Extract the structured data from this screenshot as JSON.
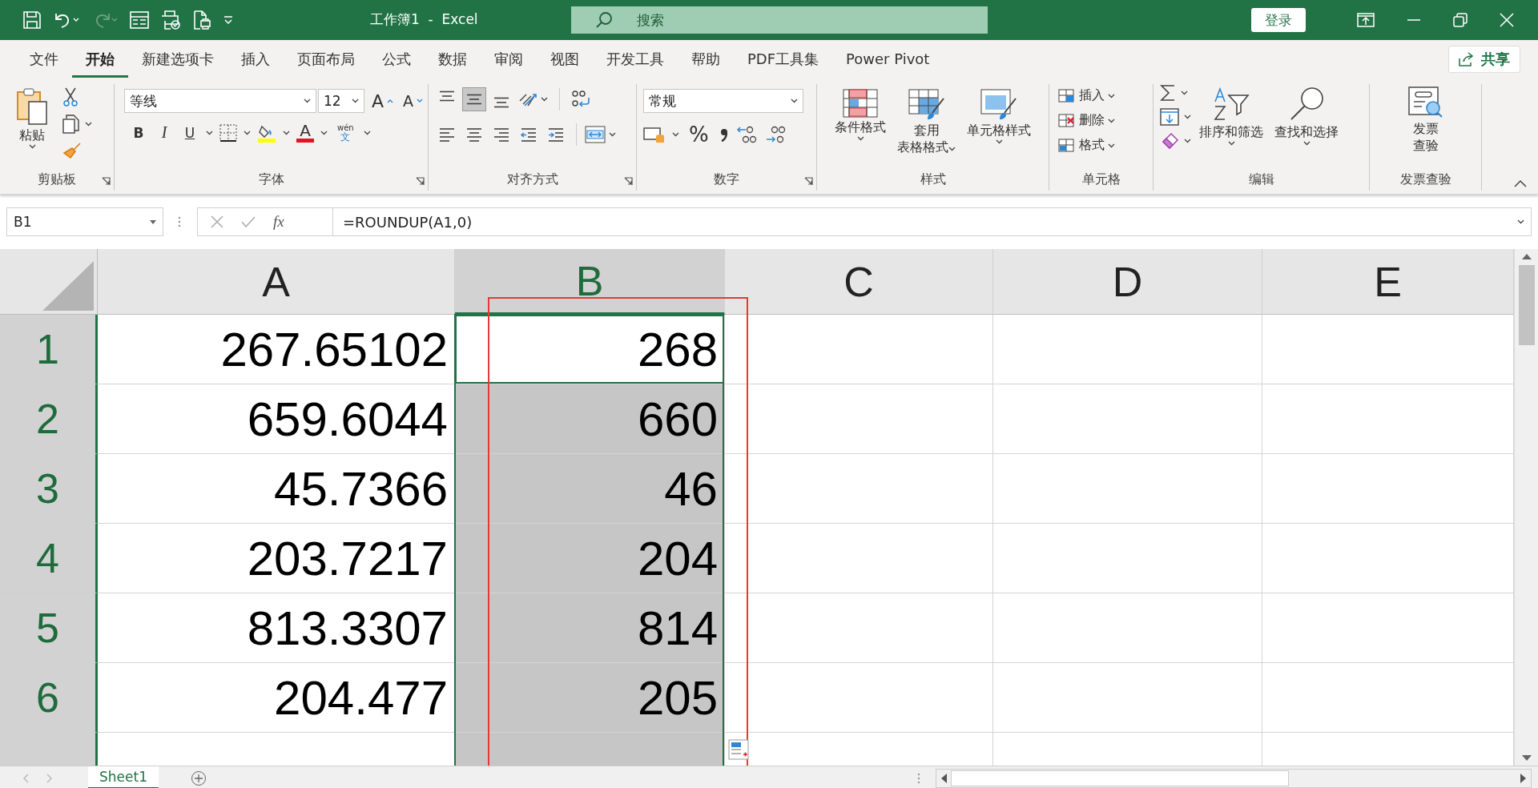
{
  "window": {
    "title": "工作簿1  -  Excel",
    "search_placeholder": "搜索",
    "login": "登录"
  },
  "menu_tabs": [
    {
      "label": "文件",
      "selected": false
    },
    {
      "label": "开始",
      "selected": true
    },
    {
      "label": "新建选项卡",
      "selected": false
    },
    {
      "label": "插入",
      "selected": false
    },
    {
      "label": "页面布局",
      "selected": false
    },
    {
      "label": "公式",
      "selected": false
    },
    {
      "label": "数据",
      "selected": false
    },
    {
      "label": "审阅",
      "selected": false
    },
    {
      "label": "视图",
      "selected": false
    },
    {
      "label": "开发工具",
      "selected": false
    },
    {
      "label": "帮助",
      "selected": false
    },
    {
      "label": "PDF工具集",
      "selected": false
    },
    {
      "label": "Power Pivot",
      "selected": false
    }
  ],
  "share": "共享",
  "ribbon": {
    "clipboard": {
      "label": "剪贴板",
      "paste": "粘贴"
    },
    "font": {
      "label": "字体",
      "font_name": "等线",
      "font_size": "12",
      "grow": "A",
      "shrink": "A",
      "bold": "B",
      "italic": "I",
      "underline": "U",
      "font_color": "A",
      "phonetic_top": "wén",
      "phonetic_bottom": "文"
    },
    "alignment": {
      "label": "对齐方式",
      "buttons": [
        {
          "kind": "top",
          "selected": false
        },
        {
          "kind": "middle",
          "selected": true
        },
        {
          "kind": "bottom",
          "selected": false
        },
        {
          "kind": "left",
          "selected": false
        },
        {
          "kind": "center",
          "selected": false
        },
        {
          "kind": "right",
          "selected": false
        },
        {
          "kind": "outdent",
          "selected": false
        },
        {
          "kind": "indent",
          "selected": false
        }
      ]
    },
    "number": {
      "label": "数字",
      "format": "常规",
      "percent": "%"
    },
    "styles": {
      "label": "样式",
      "buttons": [
        {
          "kind": "conditional",
          "lines": [
            "条件格式"
          ]
        },
        {
          "kind": "table",
          "lines": [
            "套用",
            "表格格式"
          ]
        },
        {
          "kind": "cell",
          "lines": [
            "单元格样式"
          ]
        }
      ]
    },
    "cells": {
      "label": "单元格",
      "buttons": [
        {
          "kind": "insert",
          "label": "插入"
        },
        {
          "kind": "delete",
          "label": "删除"
        },
        {
          "kind": "format",
          "label": "格式"
        }
      ]
    },
    "editing": {
      "label": "编辑",
      "sort": "排序和筛选",
      "find": "查找和选择"
    },
    "invoice": {
      "label": "发票查验",
      "lines": [
        "发票",
        "查验"
      ]
    }
  },
  "formula_bar": {
    "name_box": "B1",
    "fx": "fx",
    "formula": "=ROUNDUP(A1,0)"
  },
  "sheet": {
    "columns": [
      {
        "label": "A",
        "selected": false
      },
      {
        "label": "B",
        "selected": true
      },
      {
        "label": "C",
        "selected": false
      },
      {
        "label": "D",
        "selected": false
      },
      {
        "label": "E",
        "selected": false
      }
    ],
    "rows": [
      {
        "number": "1",
        "selected": true,
        "cells": [
          {
            "value": "267.65102"
          },
          {
            "value": "268",
            "active": true
          }
        ]
      },
      {
        "number": "2",
        "selected": true,
        "cells": [
          {
            "value": "659.6044"
          },
          {
            "value": "660",
            "selected": true,
            "active": false
          }
        ]
      },
      {
        "number": "3",
        "selected": true,
        "cells": [
          {
            "value": "45.7366"
          },
          {
            "value": "46",
            "selected": true,
            "active": false
          }
        ]
      },
      {
        "number": "4",
        "selected": true,
        "cells": [
          {
            "value": "203.7217"
          },
          {
            "value": "204",
            "selected": true,
            "active": false
          }
        ]
      },
      {
        "number": "5",
        "selected": true,
        "cells": [
          {
            "value": "813.3307"
          },
          {
            "value": "814",
            "selected": true,
            "active": false
          }
        ]
      },
      {
        "number": "6",
        "selected": true,
        "cells": [
          {
            "value": "204.477"
          },
          {
            "value": "205",
            "selected": true,
            "active": false
          }
        ]
      }
    ]
  },
  "sheet_tabs": [
    {
      "label": "Sheet1",
      "selected": true
    }
  ]
}
